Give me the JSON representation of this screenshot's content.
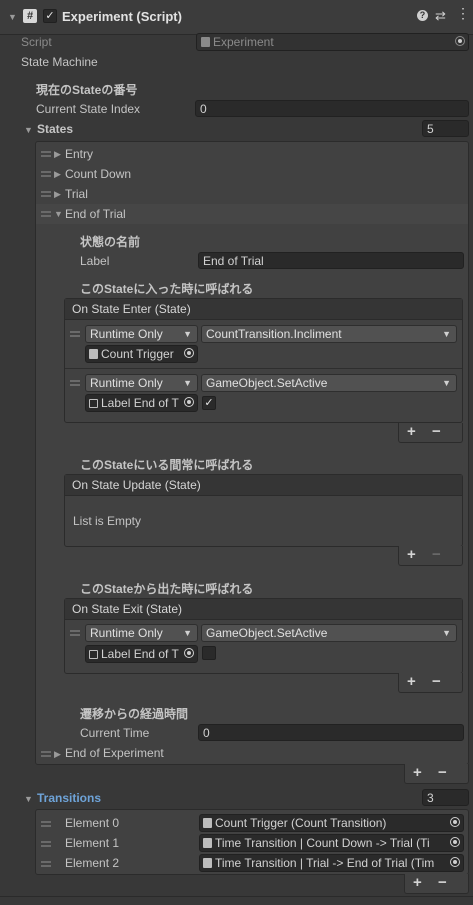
{
  "component": {
    "title": "Experiment (Script)",
    "enabled": true
  },
  "script_field": {
    "label": "Script",
    "value": "Experiment"
  },
  "state_machine": {
    "label": "State Machine"
  },
  "current_state": {
    "header": "現在のStateの番号",
    "label": "Current State Index",
    "value": "0"
  },
  "states": {
    "label": "States",
    "count": "5",
    "items": [
      "Entry",
      "Count Down",
      "Trial",
      "End of Trial",
      "End of Experiment"
    ],
    "expanded": {
      "name_header": "状態の名前",
      "label_caption": "Label",
      "label_value": "End of Trial",
      "enter_header": "このStateに入った時に呼ばれる",
      "enter_event": "On State Enter (State)",
      "enter_calls": [
        {
          "mode": "Runtime Only",
          "function": "CountTransition.Incliment",
          "object": "Count Trigger"
        },
        {
          "mode": "Runtime Only",
          "function": "GameObject.SetActive",
          "object": "Label End of T",
          "checked": true
        }
      ],
      "update_header": "このStateにいる間常に呼ばれる",
      "update_event": "On State Update (State)",
      "update_empty": "List is Empty",
      "exit_header": "このStateから出た時に呼ばれる",
      "exit_event": "On State Exit (State)",
      "exit_calls": [
        {
          "mode": "Runtime Only",
          "function": "GameObject.SetActive",
          "object": "Label End of T",
          "checked": false
        }
      ],
      "time_header": "遷移からの経過時間",
      "time_label": "Current Time",
      "time_value": "0"
    }
  },
  "transitions": {
    "label": "Transitions",
    "count": "3",
    "items": [
      {
        "label": "Element 0",
        "value": "Count Trigger (Count Transition)"
      },
      {
        "label": "Element 1",
        "value": "Time Transition | Count Down -> Trial (Ti"
      },
      {
        "label": "Element 2",
        "value": "Time Transition | Trial -> End of Trial (Tim"
      }
    ]
  },
  "buttons": {
    "plus": "+",
    "minus": "−"
  },
  "colors": {
    "background": "#383838",
    "accent_blue": "#6ea3d8",
    "field": "#2a2a2a"
  }
}
